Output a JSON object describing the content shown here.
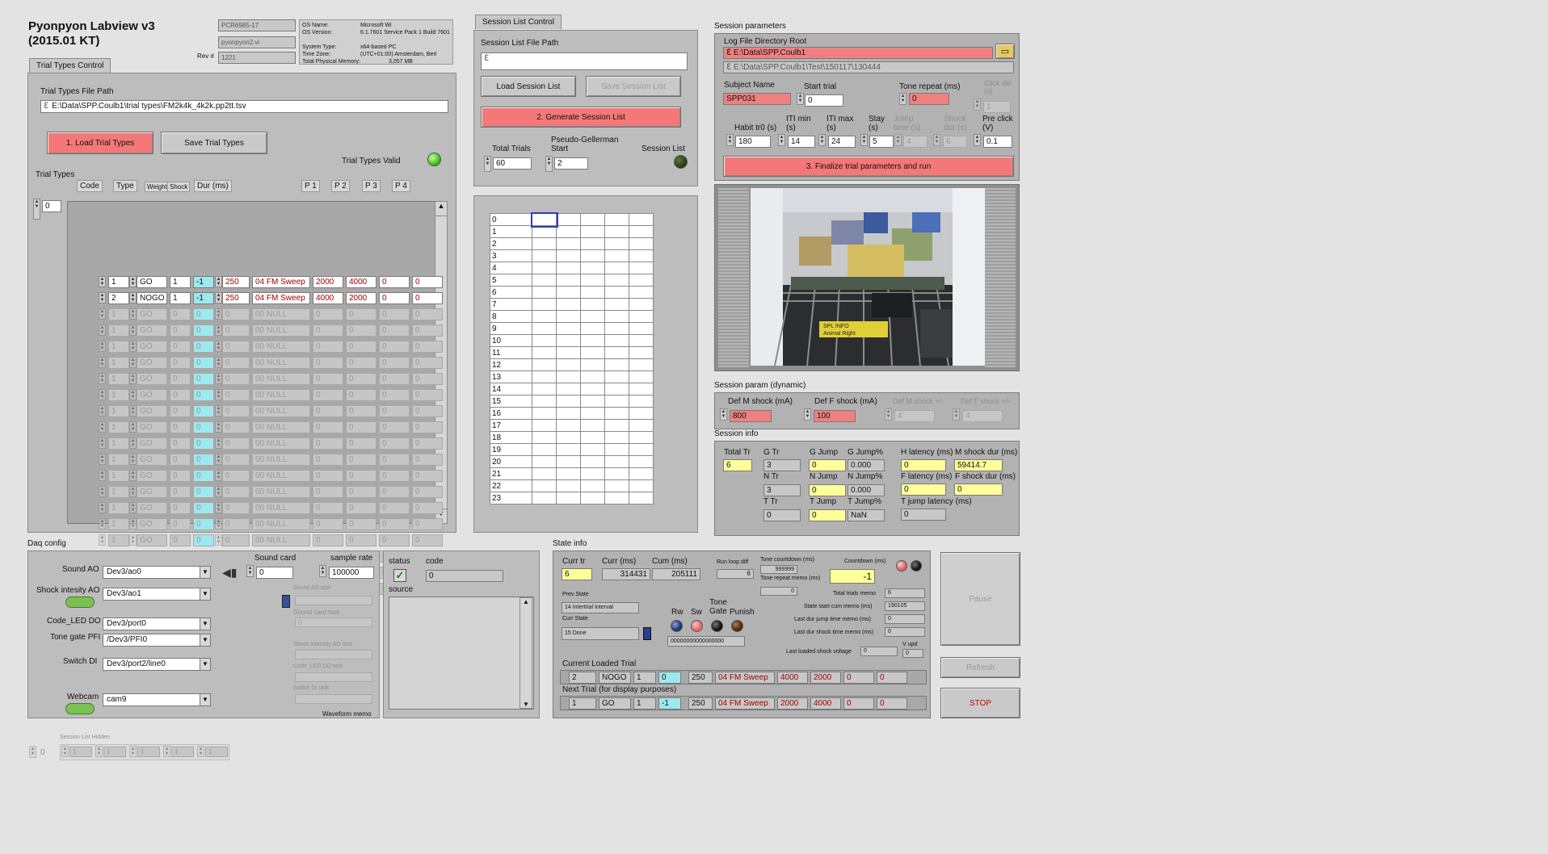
{
  "app": {
    "title_line1": "Pyonpyon Labview  v3",
    "title_line2": "(2015.01 KT)",
    "sys_host": "PCR6985-17",
    "sys_vi": "pyonpyon2.vi",
    "rev_label": "Rev #",
    "rev_value": "1221",
    "os_label": "OS Name:",
    "os_value": "Microsoft Wi",
    "osver_label": "OS Version:",
    "osver_value": "6.1.7601 Service Pack 1 Build 7601",
    "systype_label": "System Type:",
    "systype_value": "x64-based PC",
    "tz_label": "Time Zone:",
    "tz_value": "(UTC+01:00) Amsterdam, Berl",
    "mem_label": "Total Physical Memory:",
    "mem_value": "3,057 MB"
  },
  "trial_types": {
    "tab": "Trial Types Control",
    "file_path_label": "Trial Types File Path",
    "file_path": "E:\\Data\\SPP.Coulb1\\trial types\\FM2k4k_4k2k.pp2tt.tsv",
    "load_btn": "1. Load Trial Types",
    "save_btn": "Save Trial Types",
    "valid_label": "Trial Types Valid",
    "list_label": "Trial Types",
    "index": "0",
    "headers": [
      "Code",
      "Type",
      "Weight",
      "Shock",
      "Dur (ms)",
      "P 1",
      "P 2",
      "P 3",
      "P 4"
    ],
    "rows": [
      {
        "code": "1",
        "type": "GO",
        "weight": "1",
        "shock": "-1",
        "dur": "250",
        "name": "04 FM Sweep",
        "p1": "2000",
        "p2": "4000",
        "p3": "0",
        "p4": "0"
      },
      {
        "code": "2",
        "type": "NOGO",
        "weight": "1",
        "shock": "-1",
        "dur": "250",
        "name": "04 FM Sweep",
        "p1": "4000",
        "p2": "2000",
        "p3": "0",
        "p4": "0"
      },
      {
        "code": "1",
        "type": "GO",
        "weight": "0",
        "shock": "0",
        "dur": "0",
        "name": "00 NULL",
        "p1": "0",
        "p2": "0",
        "p3": "0",
        "p4": "0"
      },
      {
        "code": "1",
        "type": "GO",
        "weight": "0",
        "shock": "0",
        "dur": "0",
        "name": "00 NULL",
        "p1": "0",
        "p2": "0",
        "p3": "0",
        "p4": "0"
      },
      {
        "code": "1",
        "type": "GO",
        "weight": "0",
        "shock": "0",
        "dur": "0",
        "name": "00 NULL",
        "p1": "0",
        "p2": "0",
        "p3": "0",
        "p4": "0"
      },
      {
        "code": "1",
        "type": "GO",
        "weight": "0",
        "shock": "0",
        "dur": "0",
        "name": "00 NULL",
        "p1": "0",
        "p2": "0",
        "p3": "0",
        "p4": "0"
      },
      {
        "code": "1",
        "type": "GO",
        "weight": "0",
        "shock": "0",
        "dur": "0",
        "name": "00 NULL",
        "p1": "0",
        "p2": "0",
        "p3": "0",
        "p4": "0"
      },
      {
        "code": "1",
        "type": "GO",
        "weight": "0",
        "shock": "0",
        "dur": "0",
        "name": "00 NULL",
        "p1": "0",
        "p2": "0",
        "p3": "0",
        "p4": "0"
      },
      {
        "code": "1",
        "type": "GO",
        "weight": "0",
        "shock": "0",
        "dur": "0",
        "name": "00 NULL",
        "p1": "0",
        "p2": "0",
        "p3": "0",
        "p4": "0"
      },
      {
        "code": "1",
        "type": "GO",
        "weight": "0",
        "shock": "0",
        "dur": "0",
        "name": "00 NULL",
        "p1": "0",
        "p2": "0",
        "p3": "0",
        "p4": "0"
      },
      {
        "code": "1",
        "type": "GO",
        "weight": "0",
        "shock": "0",
        "dur": "0",
        "name": "00 NULL",
        "p1": "0",
        "p2": "0",
        "p3": "0",
        "p4": "0"
      },
      {
        "code": "1",
        "type": "GO",
        "weight": "0",
        "shock": "0",
        "dur": "0",
        "name": "00 NULL",
        "p1": "0",
        "p2": "0",
        "p3": "0",
        "p4": "0"
      },
      {
        "code": "1",
        "type": "GO",
        "weight": "0",
        "shock": "0",
        "dur": "0",
        "name": "00 NULL",
        "p1": "0",
        "p2": "0",
        "p3": "0",
        "p4": "0"
      },
      {
        "code": "1",
        "type": "GO",
        "weight": "0",
        "shock": "0",
        "dur": "0",
        "name": "00 NULL",
        "p1": "0",
        "p2": "0",
        "p3": "0",
        "p4": "0"
      },
      {
        "code": "1",
        "type": "GO",
        "weight": "0",
        "shock": "0",
        "dur": "0",
        "name": "00 NULL",
        "p1": "0",
        "p2": "0",
        "p3": "0",
        "p4": "0"
      },
      {
        "code": "1",
        "type": "GO",
        "weight": "0",
        "shock": "0",
        "dur": "0",
        "name": "00 NULL",
        "p1": "0",
        "p2": "0",
        "p3": "0",
        "p4": "0"
      },
      {
        "code": "1",
        "type": "GO",
        "weight": "0",
        "shock": "0",
        "dur": "0",
        "name": "00 NULL",
        "p1": "0",
        "p2": "0",
        "p3": "0",
        "p4": "0"
      },
      {
        "code": "1",
        "type": "GO",
        "weight": "0",
        "shock": "0",
        "dur": "0",
        "name": "00 NULL",
        "p1": "0",
        "p2": "0",
        "p3": "0",
        "p4": "0"
      },
      {
        "code": "1",
        "type": "GO",
        "weight": "0",
        "shock": "0",
        "dur": "0",
        "name": "00 NULL",
        "p1": "0",
        "p2": "0",
        "p3": "0",
        "p4": "0"
      },
      {
        "code": "1",
        "type": "GO",
        "weight": "0",
        "shock": "0",
        "dur": "0",
        "name": "00 NULL",
        "p1": "0",
        "p2": "0",
        "p3": "0",
        "p4": "0"
      }
    ]
  },
  "session_list": {
    "tab": "Session List Control",
    "file_path_label": "Session List File Path",
    "file_path": "",
    "load_btn": "Load Session List",
    "save_btn": "Save Session List",
    "generate_btn": "2. Generate Session List",
    "total_trials_label": "Total Trials",
    "total_trials": "60",
    "pg_label": "Pseudo-Gellerman Start",
    "pg_start": "2",
    "session_list_led_label": "Session List",
    "row_labels": [
      "0",
      "1",
      "2",
      "3",
      "4",
      "5",
      "6",
      "7",
      "8",
      "9",
      "10",
      "11",
      "12",
      "13",
      "14",
      "15",
      "16",
      "17",
      "18",
      "19",
      "20",
      "21",
      "22",
      "23"
    ]
  },
  "session_params": {
    "title": "Session parameters",
    "log_root_label": "Log File Directory Root",
    "log_root": "E:\\Data\\SPP.Coulb1",
    "log_sub": "E:\\Data\\SPP.Coulb1\\Test\\150117\\130444",
    "subject_label": "Subject Name",
    "subject": "SPP031",
    "start_trial_label": "Start trial",
    "start_trial": "0",
    "tone_repeat_label": "Tone repeat (ms)",
    "tone_repeat": "0",
    "click_del_label": "Click del (s)",
    "click_del": "1",
    "habit_label": "Habit tr0 (s)",
    "habit": "180",
    "iti_min_label": "ITI min (s)",
    "iti_min": "14",
    "iti_max_label": "ITI max (s)",
    "iti_max": "24",
    "stay_label": "Stay (s)",
    "stay": "5",
    "jump_time_label": "Jump time (s)",
    "jump_time": "4",
    "shock_dur_label": "Shock dur (s)",
    "shock_dur": "6",
    "pre_click_label": "Pre click (V)",
    "pre_click": "0.1",
    "finalize_btn": "3. Finalize trial parameters and run"
  },
  "webcam_frame": {
    "tag1": "SPL INFO",
    "tag2": "Animal Right"
  },
  "session_dynamic": {
    "title": "Session param (dynamic)",
    "def_m_label": "Def M shock (mA)",
    "def_m": "800",
    "def_f_label": "Def F shock (mA)",
    "def_f": "100",
    "def_m_pm_label": "Def M shock +/-",
    "def_m_pm": "4",
    "def_f_pm_label": "Def F shock +/-",
    "def_f_pm": "4"
  },
  "session_info": {
    "title": "Session info",
    "total_tr_label": "Total  Tr",
    "total_tr": "6",
    "g_tr_label": "G Tr",
    "g_tr": "3",
    "g_jump_label": "G Jump",
    "g_jump": "0",
    "g_jump_pct_label": "G Jump%",
    "g_jump_pct": "0.000",
    "h_lat_label": "H latency (ms)",
    "h_lat": "0",
    "m_shock_label": "M shock dur (ms)",
    "m_shock": "59414.7",
    "n_tr_label": "N Tr",
    "n_tr": "3",
    "n_jump_label": "N Jump",
    "n_jump": "0",
    "n_jump_pct_label": "N Jump%",
    "n_jump_pct": "0.000",
    "f_lat_label": "F latency (ms)",
    "f_lat": "0",
    "f_shock_label": "F shock dur (ms)",
    "f_shock": "0",
    "t_tr_label": "T Tr",
    "t_tr": "0",
    "t_jump_label": "T Jump",
    "t_jump": "0",
    "t_jump_pct_label": "T Jump%",
    "t_jump_pct": "NaN",
    "t_jump_lat_label": "T jump latency (ms)",
    "t_jump_lat": "0"
  },
  "daq": {
    "title": "Daq config",
    "sound_ao_label": "Sound AO",
    "sound_ao": "Dev3/ao0",
    "shock_ao_label": "Shock intesity AO",
    "shock_ao": "Dev3/ao1",
    "code_do_label": "Code_LED DO",
    "code_do": "Dev3/port0",
    "tone_pfi_label": "Tone gate PFI",
    "tone_pfi": "/Dev3/PFI0",
    "switch_di_label": "Switch DI",
    "switch_di": "Dev3/port2/line0",
    "webcam_label": "Webcam",
    "webcam": "cam9",
    "sound_card_label": "Sound card",
    "sound_card": "0",
    "sample_rate_label": "sample rate",
    "sample_rate": "100000",
    "sound_ao_task_label": "Sound AO task",
    "sound_card_task_label": "Sound card task",
    "sound_card_task": "0",
    "shock_task_label": "Shock intensity AO task",
    "code_task_label": "Code_LED DO task",
    "switch_task_label": "Switch DI task",
    "waveform_label": "Waveform memo",
    "status_label": "status",
    "code_label": "code",
    "code_value": "0",
    "source_label": "source"
  },
  "state_info": {
    "title": "State info",
    "curr_tr_label": "Curr  tr",
    "curr_tr": "6",
    "curr_ms_label": "Curr (ms)",
    "curr_ms": "314431",
    "cum_ms_label": "Cum (ms)",
    "cum_ms": "205111",
    "run_loop_label": "Run loop diff",
    "run_loop": "6",
    "tone_cd_label": "Tone countdown (ms)",
    "tone_cd": "999999",
    "tone_rep_label": "Tone repeat memo (ms)",
    "tone_rep": "0",
    "countdown_label": "Countdown (ms)",
    "countdown": "-1",
    "prev_state_label": "Prev State",
    "prev_state": "14 Intertrial Interval",
    "curr_state_label": "Curr State",
    "curr_state": "15 Done",
    "rw_label": "Rw",
    "sw_label": "Sw",
    "tone_gate_label": "Tone Gate",
    "punish_label": "Punish",
    "bits": "00000000000000000",
    "total_trials_memo_label": "Total trials memo",
    "total_trials_memo": "6",
    "state_start_label": "State start cum memo (ms)",
    "state_start": "190105",
    "last_jump_label": "Last dur jump time memo (ms)",
    "last_jump": "0",
    "last_shock_label": "Last dur shock time memo (ms)",
    "last_shock": "0",
    "last_voltage_label": "Last loaded shock voltage",
    "last_voltage": "0",
    "v_upd_label": "V upd",
    "v_upd": "0",
    "curr_loaded_label": "Current Loaded Trial",
    "curr_loaded": {
      "code": "2",
      "type": "NOGO",
      "weight": "1",
      "shock": "0",
      "dur": "250",
      "name": "04 FM Sweep",
      "p1": "4000",
      "p2": "2000",
      "p3": "0",
      "p4": "0"
    },
    "next_trial_label": "Next Trial (for display purposes)",
    "next_trial": {
      "code": "1",
      "type": "GO",
      "weight": "1",
      "shock": "-1",
      "dur": "250",
      "name": "04 FM Sweep",
      "p1": "2000",
      "p2": "4000",
      "p3": "0",
      "p4": "0"
    }
  },
  "controls": {
    "pause_btn": "Pause",
    "refresh_btn": "Refresh",
    "stop_btn": "STOP"
  },
  "hidden": {
    "label": "Session List Hidden",
    "idx": "0",
    "vals": [
      "1",
      "1",
      "1",
      "1",
      "1"
    ]
  }
}
